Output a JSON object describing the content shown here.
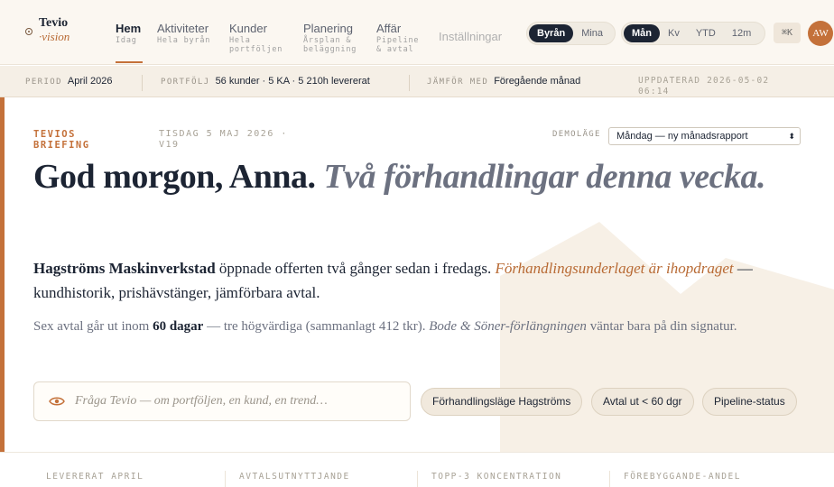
{
  "brand": {
    "name": "Tevio",
    "sub": "·vision"
  },
  "nav": [
    {
      "label": "Hem",
      "sub": "Idag",
      "active": true
    },
    {
      "label": "Aktiviteter",
      "sub": "Hela byrån"
    },
    {
      "label": "Kunder",
      "sub": "Hela portföljen"
    },
    {
      "label": "Planering",
      "sub": "Årsplan & beläggning"
    },
    {
      "label": "Affär",
      "sub": "Pipeline & avtal"
    },
    {
      "label": "Inställningar",
      "disabled": true
    }
  ],
  "scope_toggle": {
    "options": [
      "Byrån",
      "Mina"
    ],
    "selected": "Byrån"
  },
  "period_toggle": {
    "options": [
      "Mån",
      "Kv",
      "YTD",
      "12m"
    ],
    "selected": "Mån"
  },
  "shortcut": "⌘K",
  "avatar": "AW",
  "status_strip": {
    "period_key": "PERIOD",
    "period_value": "April 2026",
    "portfolio_key": "PORTFÖLJ",
    "portfolio_value": "56 kunder · 5 KA · 5 210h levererat",
    "compare_key": "JÄMFÖR MED",
    "compare_value": "Föregående månad",
    "updated": "UPPDATERAD 2026-05-02 06:14"
  },
  "briefing": {
    "kicker": "TEVIOS BRIEFING",
    "date": "TISDAG 5 MAJ 2026 · V19",
    "demo_label": "DEMOLÄGE",
    "demo_value": "Måndag — ny månadsrapport",
    "headline_main": "God morgon, Anna.",
    "headline_italic": "Två förhandlingar denna vecka.",
    "p1_client": "Hagströms Maskinverkstad",
    "p1_text": " öppnade offerten två gånger sedan i fredags. ",
    "p1_link": "Förhandlingsunderlaget är ihopdraget",
    "p1_tail": " — kundhistorik, prishävstänger, jämförbara avtal.",
    "p2_start": "Sex avtal går ut inom ",
    "p2_bold": "60 dagar",
    "p2_mid": " — tre högvärdiga (sammanlagt 412 tkr). ",
    "p2_italic": "Bode & Söner-förlängningen",
    "p2_end": " väntar bara på din signatur.",
    "ask_placeholder": "Fråga Tevio — om portföljen, en kund, en trend…",
    "chips": [
      "Förhandlingsläge Hagströms",
      "Avtal ut < 60 dgr",
      "Pipeline-status"
    ]
  },
  "kpis": [
    "LEVERERAT APRIL",
    "AVTALSUTNYTTJANDE",
    "TOPP-3 KONCENTRATION",
    "FÖREBYGGANDE-ANDEL"
  ],
  "colors": {
    "accent": "#c4713a",
    "ink": "#1c2433",
    "cream": "#fbf7f1",
    "muted": "#6c7180"
  },
  "icons": {
    "ask": "eye-icon",
    "logo": "ring-icon",
    "select": "up-down-chevron-icon"
  }
}
